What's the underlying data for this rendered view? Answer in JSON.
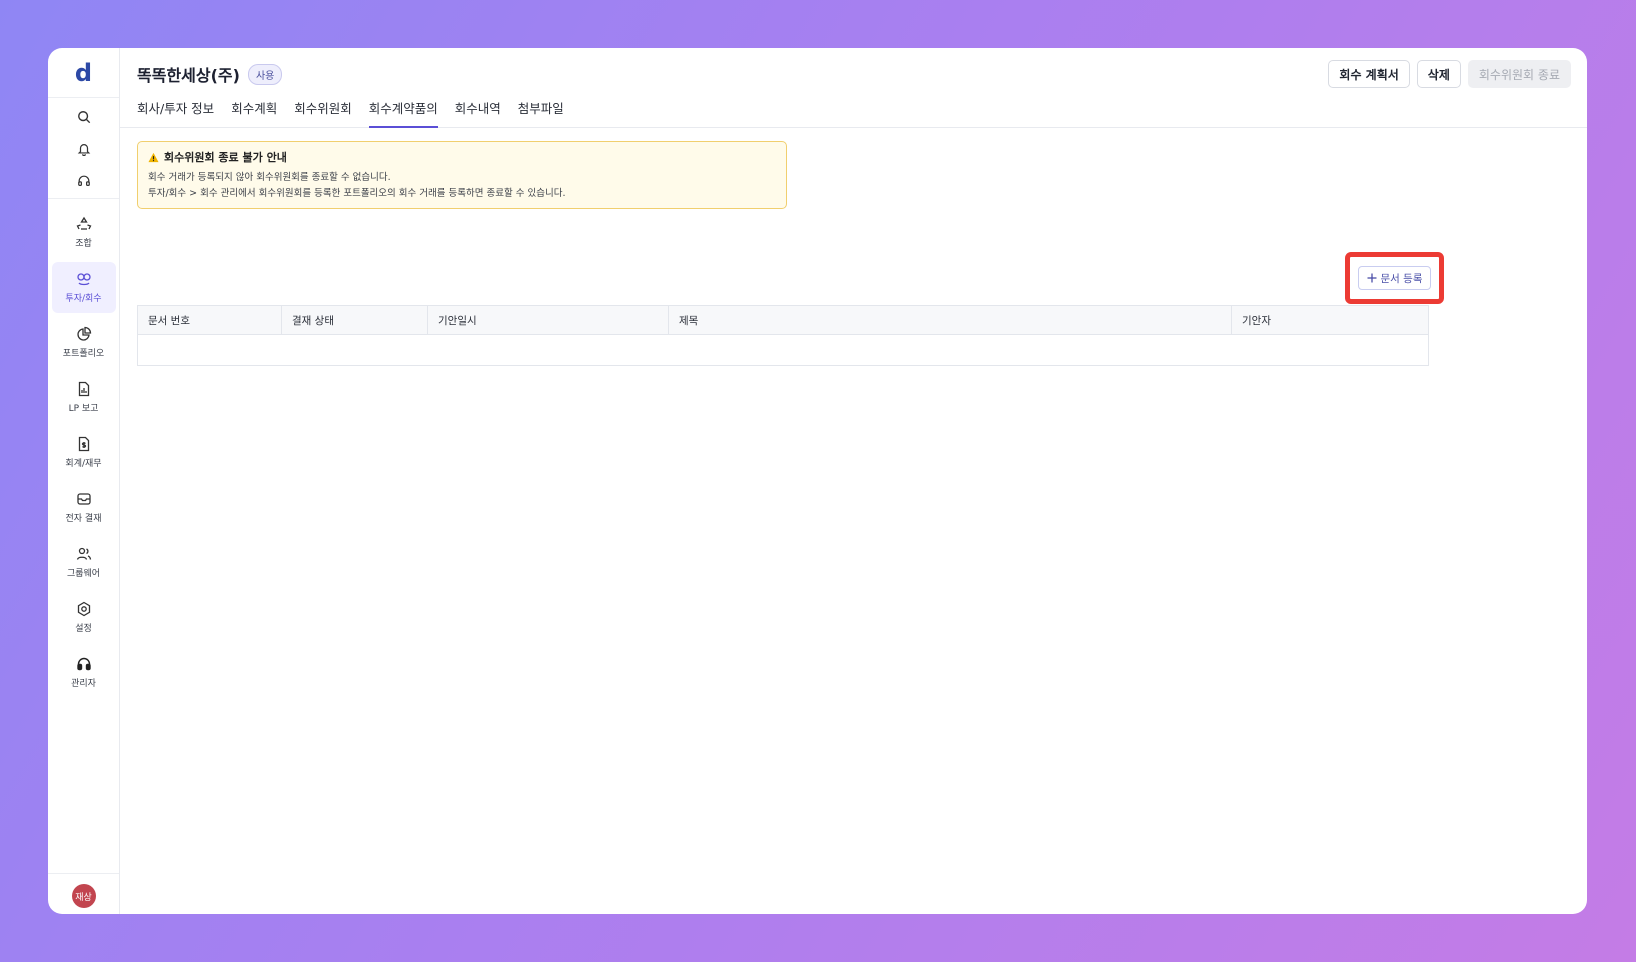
{
  "sidebar": {
    "logo": "d",
    "util_icons": [
      "search-icon",
      "bell-icon",
      "headset-icon"
    ],
    "items": [
      {
        "label": "조합",
        "icon": "recycle-icon",
        "active": false
      },
      {
        "label": "투자/회수",
        "icon": "invest-icon",
        "active": true
      },
      {
        "label": "포트폴리오",
        "icon": "pie-chart-icon",
        "active": false
      },
      {
        "label": "LP 보고",
        "icon": "report-icon",
        "active": false
      },
      {
        "label": "회계/재무",
        "icon": "finance-doc-icon",
        "active": false
      },
      {
        "label": "전자 결재",
        "icon": "inbox-icon",
        "active": false
      },
      {
        "label": "그룹웨어",
        "icon": "users-icon",
        "active": false
      },
      {
        "label": "설정",
        "icon": "gear-icon",
        "active": false
      },
      {
        "label": "관리자",
        "icon": "admin-headset-icon",
        "active": false
      }
    ],
    "avatar": "재상"
  },
  "header": {
    "company": "똑똑한세상(주)",
    "status_badge": "사용",
    "tabs": [
      "회사/투자 정보",
      "회수계획",
      "회수위원회",
      "회수계약품의",
      "회수내역",
      "첨부파일"
    ],
    "active_tab": "회수계약품의",
    "actions": {
      "plan": "회수 계획서",
      "delete": "삭제",
      "end_committee": "회수위원회 종료"
    }
  },
  "alert": {
    "title": "회수위원회 종료 불가 안내",
    "line1": "회수 거래가 등록되지 않아 회수위원회를 종료할 수 없습니다.",
    "line2": "투자/회수 > 회수 관리에서 회수위원회를 등록한 포트폴리오의 회수 거래를 등록하면 종료할 수 있습니다."
  },
  "register_button": "문서 등록",
  "table": {
    "columns": [
      "문서 번호",
      "결재 상태",
      "기안일시",
      "제목",
      "기안자"
    ],
    "rows": []
  },
  "colors": {
    "accent": "#5b4fd6",
    "highlight": "#ec3b34",
    "alert_bg": "#fffbea",
    "alert_border": "#f1cf6e",
    "avatar": "#c2454f"
  }
}
